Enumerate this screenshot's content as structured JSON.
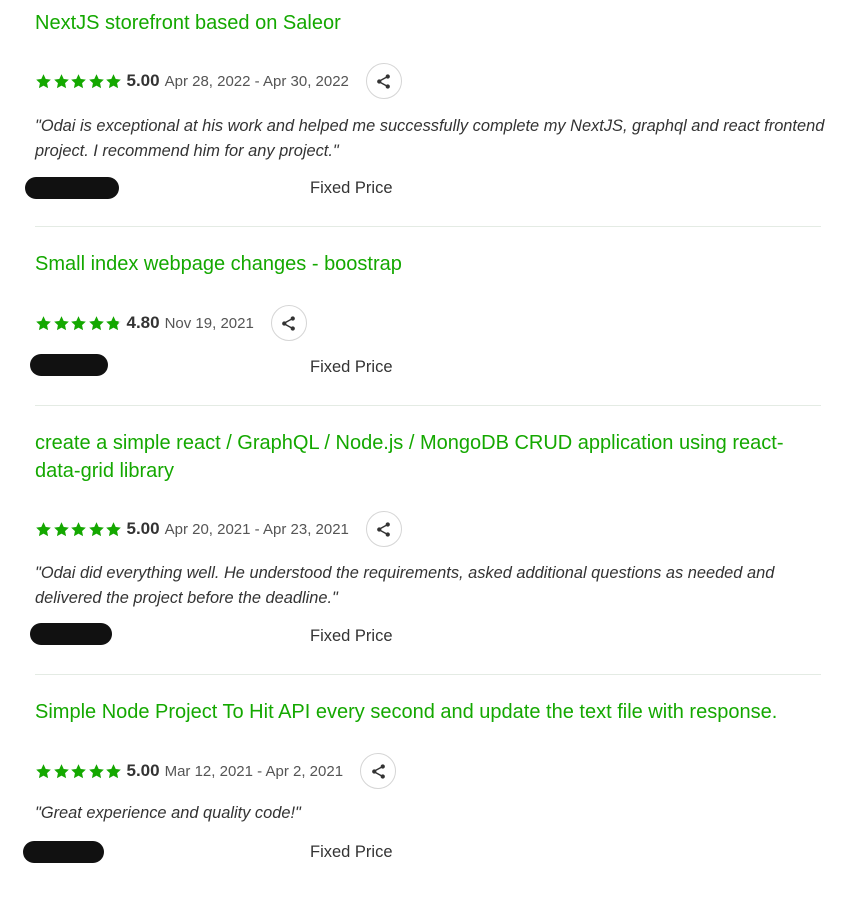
{
  "colors": {
    "accent": "#14a800",
    "star": "#14a800",
    "divider": "#e4ebe4"
  },
  "icons": {
    "star": "star-icon",
    "share": "share-icon"
  },
  "reviews": [
    {
      "title": "NextJS storefront based on Saleor",
      "rating": 5,
      "score": "5.00",
      "dates": "Apr 28, 2022 - Apr 30, 2022",
      "quote": "\"Odai is exceptional at his work and helped me successfully complete my NextJS, graphql and react frontend project. I recommend him for any project.\"",
      "price_type": "Fixed Price"
    },
    {
      "title": "Small index webpage changes - boostrap",
      "rating": 4.8,
      "score": "4.80",
      "dates": "Nov 19, 2021",
      "quote": "",
      "price_type": "Fixed Price"
    },
    {
      "title": "create a simple react / GraphQL / Node.js / MongoDB CRUD application using react-data-grid library",
      "rating": 5,
      "score": "5.00",
      "dates": "Apr 20, 2021 - Apr 23, 2021",
      "quote": "\"Odai did everything well. He understood the requirements, asked additional questions as needed and delivered the project before the deadline.\"",
      "price_type": "Fixed Price"
    },
    {
      "title": "Simple Node Project To Hit API every second and update the text file with response.",
      "rating": 5,
      "score": "5.00",
      "dates": "Mar 12, 2021 - Apr 2, 2021",
      "quote": "\"Great experience and quality code!\"",
      "price_type": "Fixed Price"
    }
  ]
}
